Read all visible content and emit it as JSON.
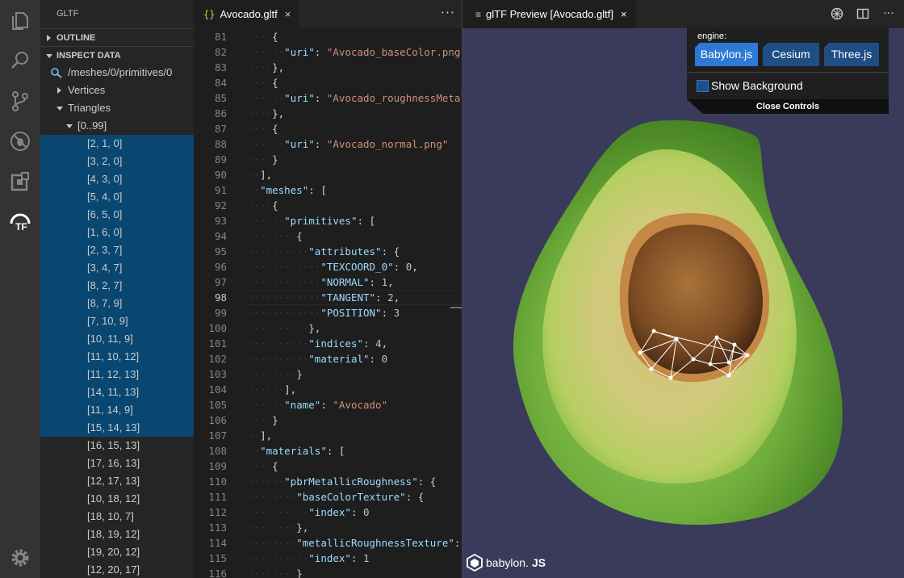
{
  "activity_bar": {
    "icons": [
      "explorer-icon",
      "search-icon",
      "source-control-icon",
      "debug-icon",
      "extensions-icon",
      "gltf-icon",
      "settings-icon"
    ]
  },
  "sidebar": {
    "title": "GLTF",
    "outline_label": "OUTLINE",
    "inspect_label": "INSPECT DATA",
    "path": "/meshes/0/primitives/0",
    "vertices_label": "Vertices",
    "triangles_label": "Triangles",
    "range_label": "[0..99]",
    "triangles": [
      "[2, 1, 0]",
      "[3, 2, 0]",
      "[4, 3, 0]",
      "[5, 4, 0]",
      "[6, 5, 0]",
      "[1, 6, 0]",
      "[2, 3, 7]",
      "[3, 4, 7]",
      "[8, 2, 7]",
      "[8, 7, 9]",
      "[7, 10, 9]",
      "[10, 11, 9]",
      "[11, 10, 12]",
      "[11, 12, 13]",
      "[14, 11, 13]",
      "[11, 14, 9]",
      "[15, 14, 13]",
      "[16, 15, 13]",
      "[17, 16, 13]",
      "[12, 17, 13]",
      "[10, 18, 12]",
      "[18, 10, 7]",
      "[18, 19, 12]",
      "[19, 20, 12]",
      "[12, 20, 17]"
    ],
    "selected_count": 17
  },
  "editor": {
    "tab_icon": "{}",
    "tab_label": "Avocado.gltf",
    "close_glyph": "×",
    "more_glyph": "···",
    "current_line": 98,
    "lines": [
      {
        "n": 81,
        "ind": 2,
        "segs": [
          [
            "p",
            "{"
          ]
        ]
      },
      {
        "n": 82,
        "ind": 3,
        "segs": [
          [
            "k",
            "\"uri\""
          ],
          [
            "p",
            ": "
          ],
          [
            "s",
            "\"Avocado_baseColor.png\""
          ]
        ]
      },
      {
        "n": 83,
        "ind": 2,
        "segs": [
          [
            "p",
            "},"
          ]
        ]
      },
      {
        "n": 84,
        "ind": 2,
        "segs": [
          [
            "p",
            "{"
          ]
        ]
      },
      {
        "n": 85,
        "ind": 3,
        "segs": [
          [
            "k",
            "\"uri\""
          ],
          [
            "p",
            ": "
          ],
          [
            "s",
            "\"Avocado_roughnessMetallic.png\""
          ]
        ]
      },
      {
        "n": 86,
        "ind": 2,
        "segs": [
          [
            "p",
            "},"
          ]
        ]
      },
      {
        "n": 87,
        "ind": 2,
        "segs": [
          [
            "p",
            "{"
          ]
        ]
      },
      {
        "n": 88,
        "ind": 3,
        "segs": [
          [
            "k",
            "\"uri\""
          ],
          [
            "p",
            ": "
          ],
          [
            "s",
            "\"Avocado_normal.png\""
          ]
        ]
      },
      {
        "n": 89,
        "ind": 2,
        "segs": [
          [
            "p",
            "}"
          ]
        ]
      },
      {
        "n": 90,
        "ind": 1,
        "segs": [
          [
            "p",
            "],"
          ]
        ]
      },
      {
        "n": 91,
        "ind": 1,
        "segs": [
          [
            "k",
            "\"meshes\""
          ],
          [
            "p",
            ": ["
          ]
        ]
      },
      {
        "n": 92,
        "ind": 2,
        "segs": [
          [
            "p",
            "{"
          ]
        ]
      },
      {
        "n": 93,
        "ind": 3,
        "segs": [
          [
            "k",
            "\"primitives\""
          ],
          [
            "p",
            ": ["
          ]
        ]
      },
      {
        "n": 94,
        "ind": 4,
        "segs": [
          [
            "p",
            "{"
          ]
        ]
      },
      {
        "n": 95,
        "ind": 5,
        "segs": [
          [
            "k",
            "\"attributes\""
          ],
          [
            "p",
            ": {"
          ]
        ]
      },
      {
        "n": 96,
        "ind": 6,
        "segs": [
          [
            "k",
            "\"TEXCOORD_0\""
          ],
          [
            "p",
            ": "
          ],
          [
            "n",
            "0"
          ],
          [
            "p",
            ","
          ]
        ]
      },
      {
        "n": 97,
        "ind": 6,
        "segs": [
          [
            "k",
            "\"NORMAL\""
          ],
          [
            "p",
            ": "
          ],
          [
            "n",
            "1"
          ],
          [
            "p",
            ","
          ]
        ]
      },
      {
        "n": 98,
        "ind": 6,
        "segs": [
          [
            "k",
            "\"TANGENT\""
          ],
          [
            "p",
            ": "
          ],
          [
            "n",
            "2"
          ],
          [
            "p",
            ","
          ]
        ]
      },
      {
        "n": 99,
        "ind": 6,
        "segs": [
          [
            "k",
            "\"POSITION\""
          ],
          [
            "p",
            ": "
          ],
          [
            "n",
            "3"
          ]
        ]
      },
      {
        "n": 100,
        "ind": 5,
        "segs": [
          [
            "p",
            "},"
          ]
        ]
      },
      {
        "n": 101,
        "ind": 5,
        "segs": [
          [
            "k",
            "\"indices\""
          ],
          [
            "p",
            ": "
          ],
          [
            "n",
            "4"
          ],
          [
            "p",
            ","
          ]
        ]
      },
      {
        "n": 102,
        "ind": 5,
        "segs": [
          [
            "k",
            "\"material\""
          ],
          [
            "p",
            ": "
          ],
          [
            "n",
            "0"
          ]
        ]
      },
      {
        "n": 103,
        "ind": 4,
        "segs": [
          [
            "p",
            "}"
          ]
        ]
      },
      {
        "n": 104,
        "ind": 3,
        "segs": [
          [
            "p",
            "],"
          ]
        ]
      },
      {
        "n": 105,
        "ind": 3,
        "segs": [
          [
            "k",
            "\"name\""
          ],
          [
            "p",
            ": "
          ],
          [
            "s",
            "\"Avocado\""
          ]
        ]
      },
      {
        "n": 106,
        "ind": 2,
        "segs": [
          [
            "p",
            "}"
          ]
        ]
      },
      {
        "n": 107,
        "ind": 1,
        "segs": [
          [
            "p",
            "],"
          ]
        ]
      },
      {
        "n": 108,
        "ind": 1,
        "segs": [
          [
            "k",
            "\"materials\""
          ],
          [
            "p",
            ": ["
          ]
        ]
      },
      {
        "n": 109,
        "ind": 2,
        "segs": [
          [
            "p",
            "{"
          ]
        ]
      },
      {
        "n": 110,
        "ind": 3,
        "segs": [
          [
            "k",
            "\"pbrMetallicRoughness\""
          ],
          [
            "p",
            ": {"
          ]
        ]
      },
      {
        "n": 111,
        "ind": 4,
        "segs": [
          [
            "k",
            "\"baseColorTexture\""
          ],
          [
            "p",
            ": {"
          ]
        ]
      },
      {
        "n": 112,
        "ind": 5,
        "segs": [
          [
            "k",
            "\"index\""
          ],
          [
            "p",
            ": "
          ],
          [
            "n",
            "0"
          ]
        ]
      },
      {
        "n": 113,
        "ind": 4,
        "segs": [
          [
            "p",
            "},"
          ]
        ]
      },
      {
        "n": 114,
        "ind": 4,
        "segs": [
          [
            "k",
            "\"metallicRoughnessTexture\""
          ],
          [
            "p",
            ": {"
          ]
        ]
      },
      {
        "n": 115,
        "ind": 5,
        "segs": [
          [
            "k",
            "\"index\""
          ],
          [
            "p",
            ": "
          ],
          [
            "n",
            "1"
          ]
        ]
      },
      {
        "n": 116,
        "ind": 4,
        "segs": [
          [
            "p",
            "}"
          ]
        ]
      }
    ]
  },
  "preview": {
    "tab_label": "glTF Preview [Avocado.gltf]",
    "close_glyph": "×",
    "engine_label": "engine:",
    "engines": [
      "Babylon.js",
      "Cesium",
      "Three.js"
    ],
    "active_engine": "Babylon.js",
    "show_background_label": "Show Background",
    "show_background": false,
    "close_controls_label": "Close Controls",
    "logo_text": "babylon.",
    "logo_js": "JS",
    "colors": {
      "background": "#3a3a5b",
      "accent": "#2c7ad6"
    }
  }
}
